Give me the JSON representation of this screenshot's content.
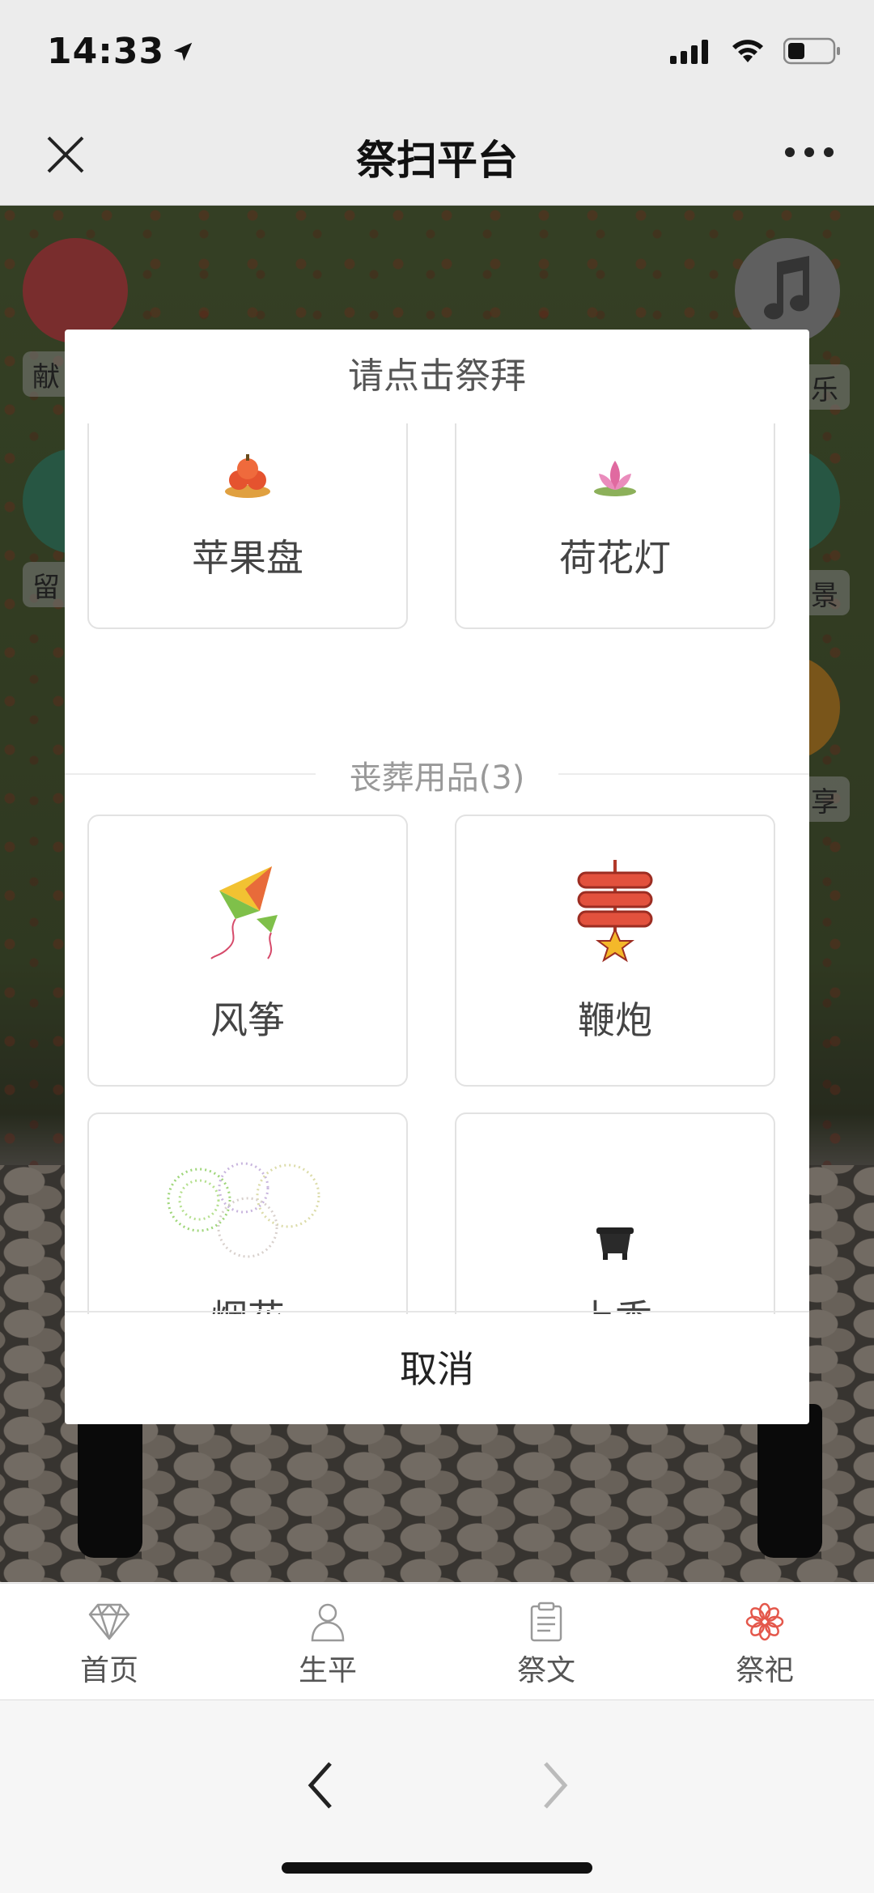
{
  "status_bar": {
    "time": "14:33"
  },
  "nav": {
    "title": "祭扫平台"
  },
  "background": {
    "side_labels_left": [
      "献",
      "留"
    ],
    "side_labels_right": [
      "乐",
      "景",
      "享"
    ]
  },
  "modal": {
    "title": "请点击祭拜",
    "items_top": [
      {
        "label": "苹果盘",
        "icon": "apple-plate-icon"
      },
      {
        "label": "荷花灯",
        "icon": "lotus-lamp-icon"
      }
    ],
    "section": {
      "title": "丧葬用品(3)"
    },
    "items_bottom": [
      {
        "label": "风筝",
        "icon": "kite-icon"
      },
      {
        "label": "鞭炮",
        "icon": "firecracker-icon"
      },
      {
        "label": "烟花",
        "icon": "fireworks-icon"
      },
      {
        "label": "上香",
        "icon": "incense-burner-icon"
      }
    ],
    "cancel_label": "取消"
  },
  "tabs": [
    {
      "label": "首页",
      "icon": "diamond-icon"
    },
    {
      "label": "生平",
      "icon": "person-icon"
    },
    {
      "label": "祭文",
      "icon": "clipboard-icon"
    },
    {
      "label": "祭祀",
      "icon": "flower-icon",
      "active": true
    }
  ],
  "colors": {
    "accent": "#e4574b",
    "modal_bg": "#ffffff",
    "section_text": "#999999"
  }
}
